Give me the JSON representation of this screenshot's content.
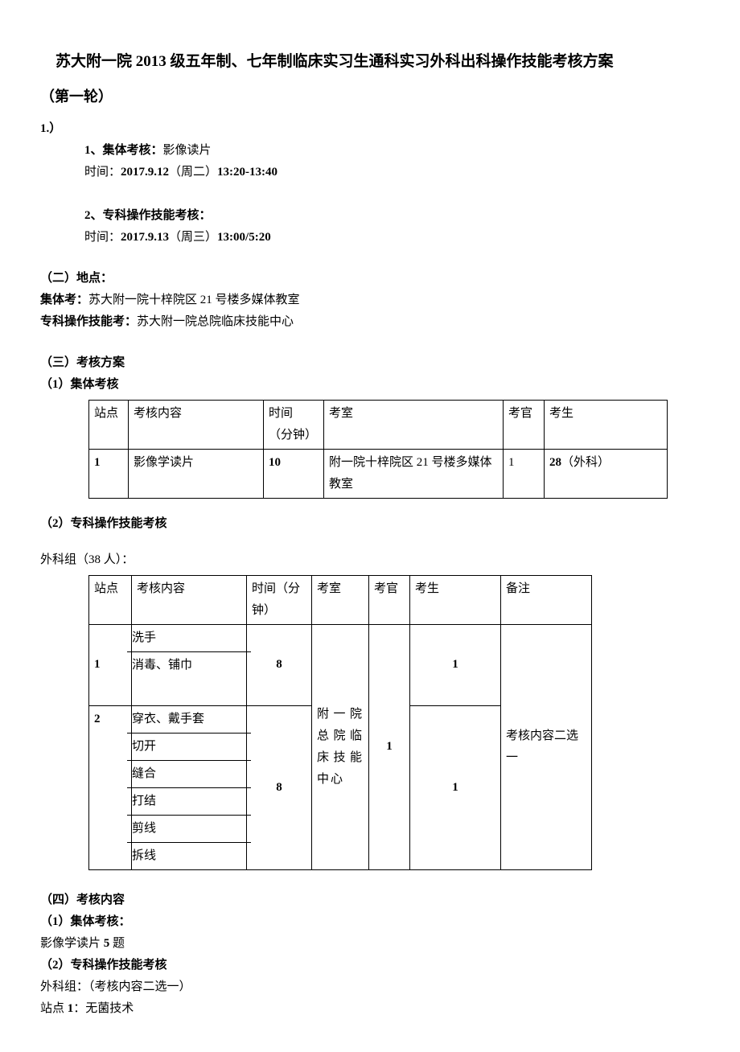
{
  "title": "苏大附一院 2013 级五年制、七年制临床实习生通科实习外科出科操作技能考核方案",
  "round": "（第一轮）",
  "sec1_num": "1.）",
  "item1_label": "1、集体考核：",
  "item1_text": "影像读片",
  "item1_time_label": "时间：",
  "item1_time_value": "2017.9.12",
  "item1_time_day": "（周二）",
  "item1_time_range": "13:20-13:40",
  "item2_label": "2、专科操作技能考核：",
  "item2_time_label": "时间：",
  "item2_time_value": "2017.9.13",
  "item2_time_day": "（周三）",
  "item2_time_range": "13:00/5:20",
  "sec2_label": "（二）地点：",
  "sec2_line1_label": "集体考：",
  "sec2_line1_text": "苏大附一院十梓院区 21 号楼多媒体教室",
  "sec2_line2_label": "专科操作技能考：",
  "sec2_line2_text": "苏大附一院总院临床技能中心",
  "sec3_label": "（三）考核方案",
  "sec3_sub1": "（1）集体考核",
  "table1": {
    "headers": {
      "c1": "站点",
      "c2": "考核内容",
      "c3_a": "时间",
      "c3_b": "（分钟）",
      "c4": "考室",
      "c5": "考官",
      "c6": "考生"
    },
    "row": {
      "c1": "1",
      "c2": "影像学读片",
      "c3": "10",
      "c4": "附一院十梓院区 21 号楼多媒体教室",
      "c5": "1",
      "c6_bold": "28",
      "c6_rest": "（外科）"
    }
  },
  "sec3_sub2": "（2）专科操作技能考核",
  "group_label": "外科组（38 人）：",
  "table2": {
    "headers": {
      "c1": "站点",
      "c2": "考核内容",
      "c3": "时间（分钟）",
      "c4": "考室",
      "c5": "考官",
      "c6": "考生",
      "c7": "备注"
    },
    "r1": {
      "c1": "1",
      "c2a": "洗手",
      "c2b": "消毒、铺巾",
      "c3": "8"
    },
    "r2": {
      "c1": "2",
      "c2a": "穿衣、戴手套",
      "c2b": "切开",
      "c2c": "缝合",
      "c2d": "打结",
      "c2e": "剪线",
      "c2f": "拆线",
      "c3": "8"
    },
    "shared": {
      "c4": "附一院总院临床技能中心",
      "c5": "1",
      "c6a": "1",
      "c6b": "1",
      "c7": "考核内容二选一"
    }
  },
  "sec4_label": "（四）考核内容",
  "sec4_sub1": "（1）集体考核：",
  "sec4_line1_a": "影像学读片 ",
  "sec4_line1_b": "5",
  "sec4_line1_c": " 题",
  "sec4_sub2": "（2）专科操作技能考核",
  "sec4_line2": "外科组：（考核内容二选一）",
  "sec4_line3_a": "站点 ",
  "sec4_line3_b": "1",
  "sec4_line3_c": "：无菌技术"
}
